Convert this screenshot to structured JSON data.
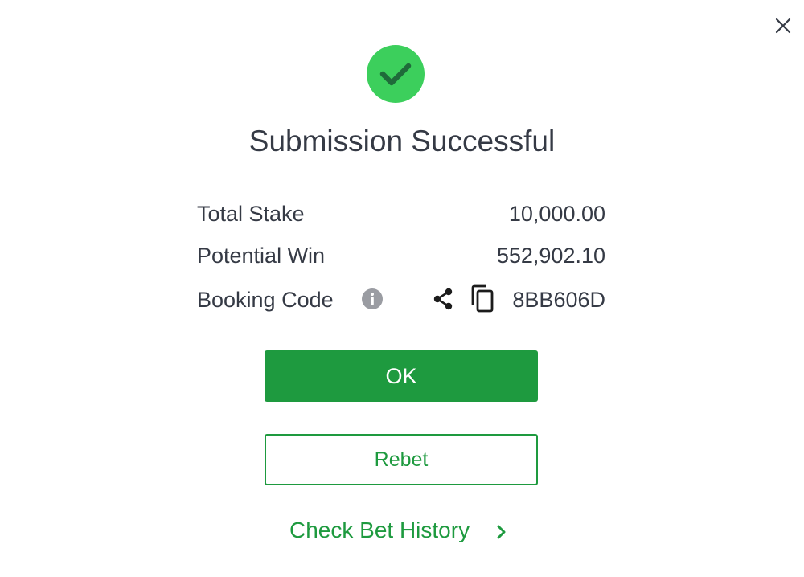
{
  "dialog": {
    "title": "Submission Successful",
    "close_icon": "close-icon",
    "status_icon": "success-check-icon",
    "accent_color": "#1e9a3f",
    "success_color": "#3ccf5c"
  },
  "summary": {
    "total_stake": {
      "label": "Total Stake",
      "value": "10,000.00"
    },
    "potential_win": {
      "label": "Potential Win",
      "value": "552,902.10"
    },
    "booking_code": {
      "label": "Booking Code",
      "value": "8BB606D",
      "info_icon": "info-icon",
      "share_icon": "share-icon",
      "copy_icon": "copy-icon"
    }
  },
  "actions": {
    "ok_label": "OK",
    "rebet_label": "Rebet",
    "history_label": "Check Bet History",
    "history_icon": "chevron-right-icon"
  }
}
